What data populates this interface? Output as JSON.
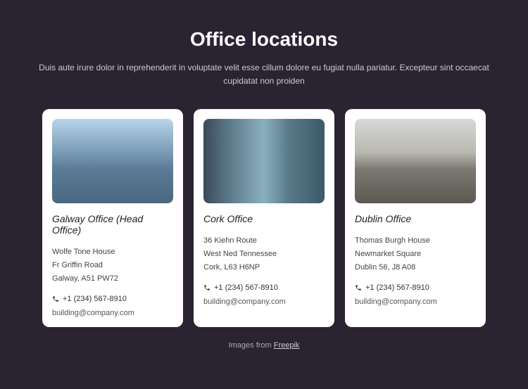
{
  "title": "Office locations",
  "subtitle": "Duis aute irure dolor in reprehenderit in voluptate velit esse cillum dolore eu fugiat nulla pariatur. Excepteur sint occaecat cupidatat non proiden",
  "offices": [
    {
      "name": "Galway Office (Head Office)",
      "addr1": "Wolfe Tone House",
      "addr2": "Fr Griffin Road",
      "addr3": "Galway, A51 PW72",
      "phone": "+1 (234) 567-8910",
      "email": "building@company.com"
    },
    {
      "name": "Cork Office",
      "addr1": "36 Kiehn Route",
      "addr2": "West Ned Tennessee",
      "addr3": "Cork, L63 H6NP",
      "phone": "+1 (234) 567-8910",
      "email": "building@company.com"
    },
    {
      "name": "Dublin Office",
      "addr1": "Thomas Burgh House",
      "addr2": "Newmarket Square",
      "addr3": "Dublin 56, J8 A08",
      "phone": "+1 (234) 567-8910",
      "email": "building@company.com"
    }
  ],
  "footer_text": "Images from ",
  "footer_link": "Freepik"
}
